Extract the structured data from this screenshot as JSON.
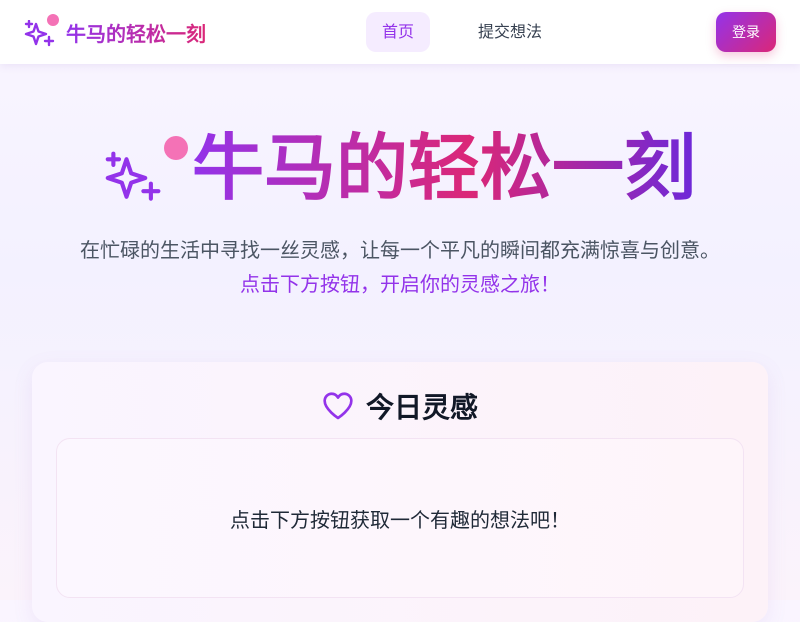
{
  "navbar": {
    "brand": "牛马的轻松一刻",
    "brand_icon": "sparkles-icon",
    "links": [
      {
        "label": "首页",
        "active": true
      },
      {
        "label": "提交想法",
        "active": false
      }
    ],
    "login_label": "登录"
  },
  "hero": {
    "title": "牛马的轻松一刻",
    "icon": "sparkles-icon",
    "subtitle": "在忙碌的生活中寻找一丝灵感，让每一个平凡的瞬间都充满惊喜与创意。",
    "cta": "点击下方按钮，开启你的灵感之旅！"
  },
  "inspiration_card": {
    "icon": "heart-icon",
    "title": "今日灵感",
    "placeholder": "点击下方按钮获取一个有趣的想法吧！"
  },
  "colors": {
    "primary_purple": "#9333ea",
    "primary_pink": "#db2777",
    "accent_dot": "#f472b6",
    "active_nav_bg": "#f5ecff"
  }
}
